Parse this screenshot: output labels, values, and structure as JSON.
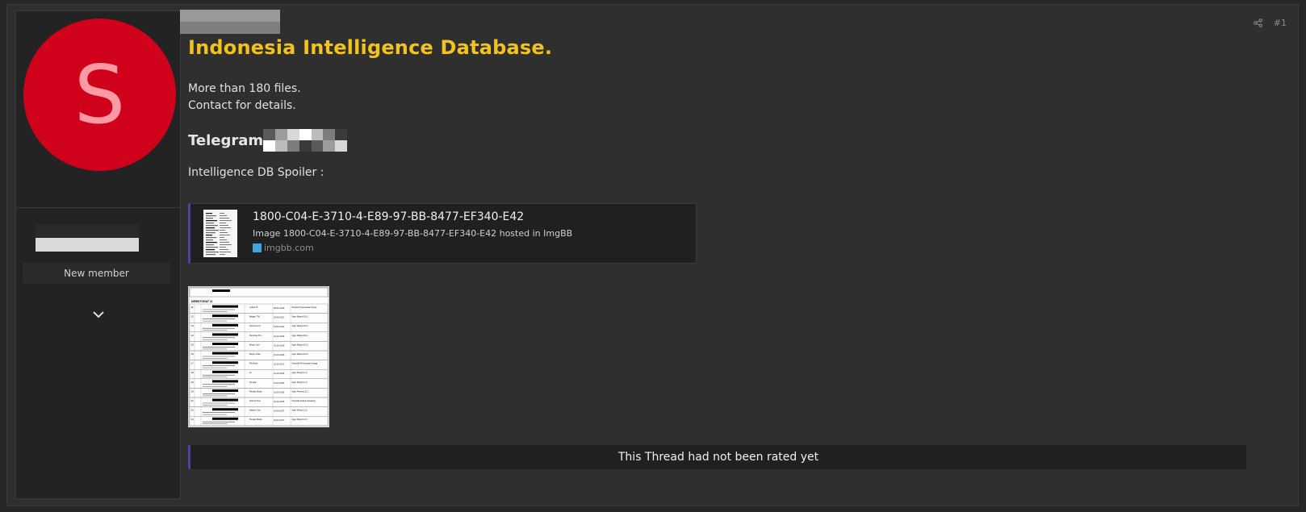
{
  "author": {
    "avatar_letter": "S",
    "avatar_color": "#d0021b",
    "role": "New member"
  },
  "post": {
    "number": "#1",
    "title": "Indonesia Intelligence Database.",
    "description_line1": "More than 180 files.",
    "description_line2": "Contact for details.",
    "telegram_label": "Telegram",
    "spoiler_label": "Intelligence DB Spoiler :",
    "title_color": "#f2c31d"
  },
  "embed": {
    "title": "1800-C04-E-3710-4-E89-97-BB-8477-EF340-E42",
    "description": "Image 1800-C04-E-3710-4-E89-97-BB-8477-EF340-E42 hosted in ImgBB",
    "site": "imgbb.com"
  },
  "document_preview": {
    "section_label": "DIREKTORAT 11",
    "rows": [
      {
        "no": "11",
        "rank": "Letkol Tit",
        "date": "28-02-2019",
        "position": "Direktur Perencanaan Pengendalian Kegiatan dan Operasi Direktur 11"
      },
      {
        "no": "12",
        "rank": "Brigjen TNI",
        "date": "18-09-2017",
        "position": "Agen Madya Dit 11"
      },
      {
        "no": "13",
        "rank": "Kolonel Arm",
        "date": "15-03-2012",
        "position": "Agen Madya Dit 11"
      },
      {
        "no": "14",
        "rank": "Pembina TK.I",
        "date": "01-10-2016",
        "position": "Agen Madya Dit 11"
      },
      {
        "no": "15",
        "rank": "Mayor Cpn",
        "date": "01-10-2016",
        "position": "Agen Madya Dit 11"
      },
      {
        "no": "16",
        "rank": "Mayor Infan",
        "date": "01-10-2016",
        "position": "Agen Madya Dit 11"
      },
      {
        "no": "17",
        "rank": "Pembina",
        "date": "01-10-2017",
        "position": "Kasubdit Perencanaan Anggaran"
      },
      {
        "no": "18",
        "rank": "Ini",
        "date": "01-10-2016",
        "position": "Agen Muda (11 1)"
      },
      {
        "no": "19",
        "rank": "Penata",
        "date": "01-04-2016",
        "position": "Agen Muda (11 1)"
      },
      {
        "no": "20",
        "rank": "Penata Muda",
        "date": "01-04-2016",
        "position": "Agen Pertama 11 1"
      },
      {
        "no": "21",
        "rank": "Kolonel Sus",
        "date": "01-10-2016",
        "position": "Kasubdit Analisa & Evaluasi"
      },
      {
        "no": "22",
        "rank": "Kapten Cpn",
        "date": "01-04-2017",
        "position": "Agen Muda (11 2)"
      },
      {
        "no": "23",
        "rank": "Penata Muda",
        "date": "01-04-2017",
        "position": "Agen Muda (11 2)"
      }
    ]
  },
  "rating": {
    "text": "This Thread had not been rated yet"
  },
  "colors": {
    "accent_border": "#47479e",
    "background": "#272727",
    "panel": "#2f2f2f"
  }
}
